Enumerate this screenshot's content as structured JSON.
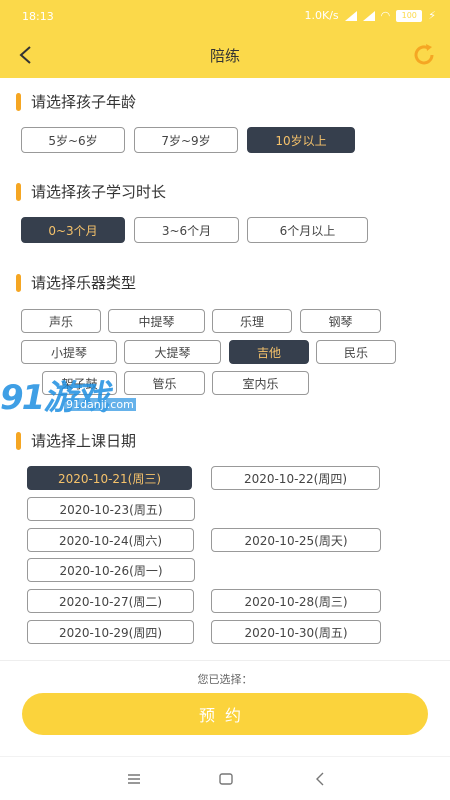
{
  "status": {
    "time": "18:13",
    "speed": "1.0K/s",
    "battery": "100"
  },
  "nav": {
    "title": "陪练",
    "back_icon": "back-arrow-icon",
    "refresh_icon": "refresh-icon"
  },
  "sections": {
    "age": {
      "title": "请选择孩子年龄",
      "options": [
        "5岁~6岁",
        "7岁~9岁",
        "10岁以上"
      ],
      "selected": "10岁以上"
    },
    "duration": {
      "title": "请选择孩子学习时长",
      "options": [
        "0~3个月",
        "3~6个月",
        "6个月以上"
      ],
      "selected": "0~3个月"
    },
    "instrument": {
      "title": "请选择乐器类型",
      "options": [
        "声乐",
        "中提琴",
        "乐理",
        "钢琴",
        "小提琴",
        "大提琴",
        "吉他",
        "民乐",
        "架子鼓",
        "管乐",
        "室内乐"
      ],
      "selected": "吉他"
    },
    "date": {
      "title": "请选择上课日期",
      "options": [
        "2020-10-21(周三)",
        "2020-10-22(周四)",
        "2020-10-23(周五)",
        "2020-10-24(周六)",
        "2020-10-25(周天)",
        "2020-10-26(周一)",
        "2020-10-27(周二)",
        "2020-10-28(周三)",
        "2020-10-29(周四)",
        "2020-10-30(周五)"
      ],
      "selected": "2020-10-21(周三)"
    }
  },
  "footer": {
    "selected_label": "您已选择：",
    "book_button": "预约"
  },
  "watermark": {
    "big": "91游戏",
    "small": "91danji.com"
  },
  "colors": {
    "header": "#fbd94a",
    "selected_chip": "#363f4d",
    "accent_bar": "#f5a623",
    "book_button": "#fbd33c"
  }
}
